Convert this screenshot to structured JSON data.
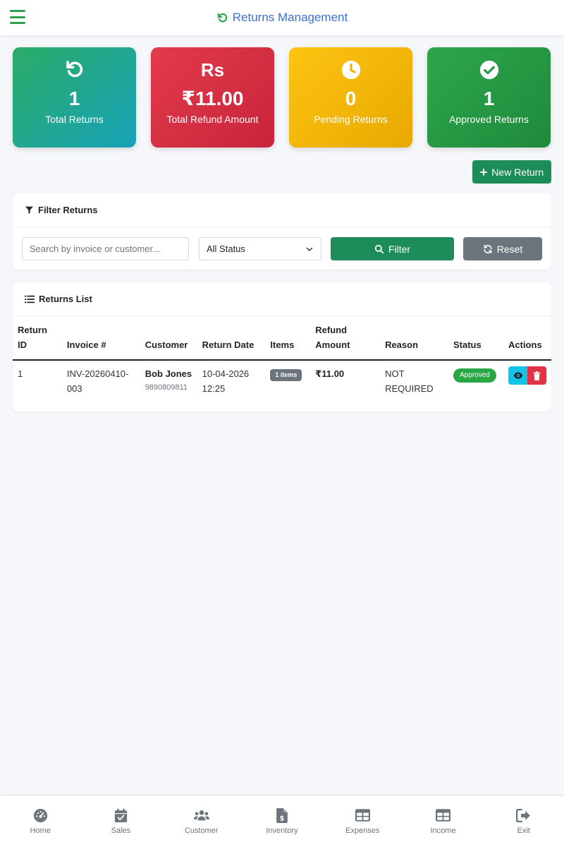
{
  "header": {
    "title": "Returns Management"
  },
  "stats": [
    {
      "value": "1",
      "label": "Total Returns",
      "icon": "undo-icon"
    },
    {
      "value": "₹11.00",
      "label": "Total Refund Amount",
      "icon": "rupee-icon",
      "icon_text": "Rs"
    },
    {
      "value": "0",
      "label": "Pending Returns",
      "icon": "clock-icon"
    },
    {
      "value": "1",
      "label": "Approved Returns",
      "icon": "check-circle-icon"
    }
  ],
  "actions": {
    "new_return": "New Return"
  },
  "filter": {
    "title": "Filter Returns",
    "search_placeholder": "Search by invoice or customer...",
    "status_selected": "All Status",
    "filter_label": "Filter",
    "reset_label": "Reset"
  },
  "list": {
    "title": "Returns List",
    "columns": [
      "Return ID",
      "Invoice #",
      "Customer",
      "Return Date",
      "Items",
      "Refund Amount",
      "Reason",
      "Status",
      "Actions"
    ],
    "rows": [
      {
        "return_id": "1",
        "invoice": "INV-20260410-003",
        "customer_name": "Bob Jones",
        "customer_phone": "9890809811",
        "return_date": "10-04-2026 12:25",
        "items": "1 items",
        "refund_amount": "₹11.00",
        "reason": "NOT REQUIRED",
        "status": "Approved"
      }
    ]
  },
  "nav": {
    "items": [
      {
        "label": "Home",
        "icon": "dashboard-icon"
      },
      {
        "label": "Sales",
        "icon": "calendar-check-icon"
      },
      {
        "label": "Customer",
        "icon": "users-icon"
      },
      {
        "label": "Inventory",
        "icon": "file-dollar-icon"
      },
      {
        "label": "Expenses",
        "icon": "table-icon"
      },
      {
        "label": "Income",
        "icon": "table-icon"
      },
      {
        "label": "Exit",
        "icon": "sign-out-icon"
      }
    ]
  },
  "colors": {
    "primary_green": "#1c8c58",
    "title_blue": "#3a6fd8",
    "danger": "#e03445",
    "info": "#12c4e6",
    "warning": "#fcc412",
    "success": "#28a745",
    "secondary": "#6c757d"
  }
}
